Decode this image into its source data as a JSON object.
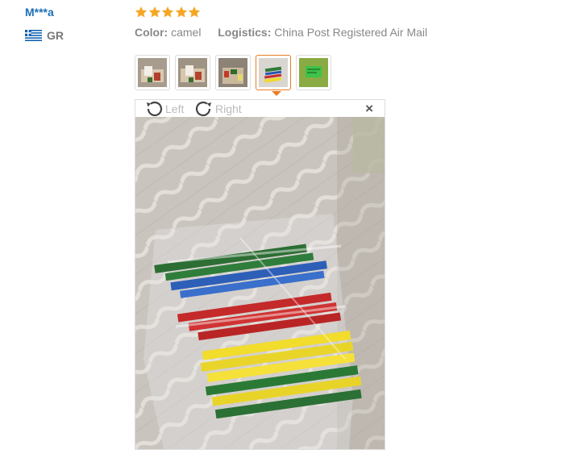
{
  "review": {
    "user_name": "M***a",
    "country_code": "GR",
    "rating": 5,
    "color_label": "Color:",
    "color_value": "camel",
    "logistics_label": "Logistics:",
    "logistics_value": "China Post Registered Air Mail"
  },
  "gallery": {
    "thumbnail_count": 5,
    "active_index": 3
  },
  "viewer": {
    "rotate_left_label": "Left",
    "rotate_right_label": "Right",
    "close_label": "×"
  },
  "colors": {
    "star": "#f5a623",
    "user_link": "#1c6fb6",
    "active_border": "#e87e24"
  }
}
